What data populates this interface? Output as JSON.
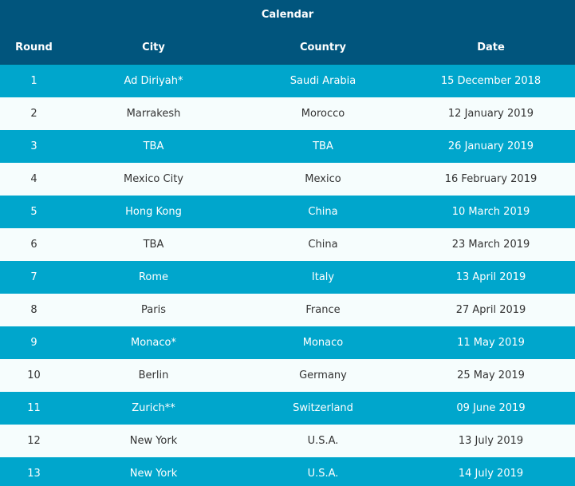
{
  "title": "Calendar",
  "columns": {
    "round": "Round",
    "city": "City",
    "country": "Country",
    "date": "Date"
  },
  "rows": [
    {
      "round": "1",
      "city": "Ad Diriyah*",
      "country": "Saudi Arabia",
      "date": "15 December 2018"
    },
    {
      "round": "2",
      "city": "Marrakesh",
      "country": "Morocco",
      "date": "12 January 2019"
    },
    {
      "round": "3",
      "city": "TBA",
      "country": "TBA",
      "date": "26 January 2019"
    },
    {
      "round": "4",
      "city": "Mexico City",
      "country": "Mexico",
      "date": "16 February 2019"
    },
    {
      "round": "5",
      "city": "Hong Kong",
      "country": "China",
      "date": "10 March 2019"
    },
    {
      "round": "6",
      "city": "TBA",
      "country": "China",
      "date": "23 March 2019"
    },
    {
      "round": "7",
      "city": "Rome",
      "country": "Italy",
      "date": "13 April 2019"
    },
    {
      "round": "8",
      "city": "Paris",
      "country": "France",
      "date": "27 April 2019"
    },
    {
      "round": "9",
      "city": "Monaco*",
      "country": "Monaco",
      "date": "11 May 2019"
    },
    {
      "round": "10",
      "city": "Berlin",
      "country": "Germany",
      "date": "25 May 2019"
    },
    {
      "round": "11",
      "city": "Zurich**",
      "country": "Switzerland",
      "date": "09 June 2019"
    },
    {
      "round": "12",
      "city": "New York",
      "country": "U.S.A.",
      "date": "13 July 2019"
    },
    {
      "round": "13",
      "city": "New York",
      "country": "U.S.A.",
      "date": "14 July 2019"
    }
  ],
  "colors": {
    "header_bg": "#01557d",
    "odd_row_bg": "#00a6cc",
    "even_row_bg": "#f6fdfd"
  }
}
